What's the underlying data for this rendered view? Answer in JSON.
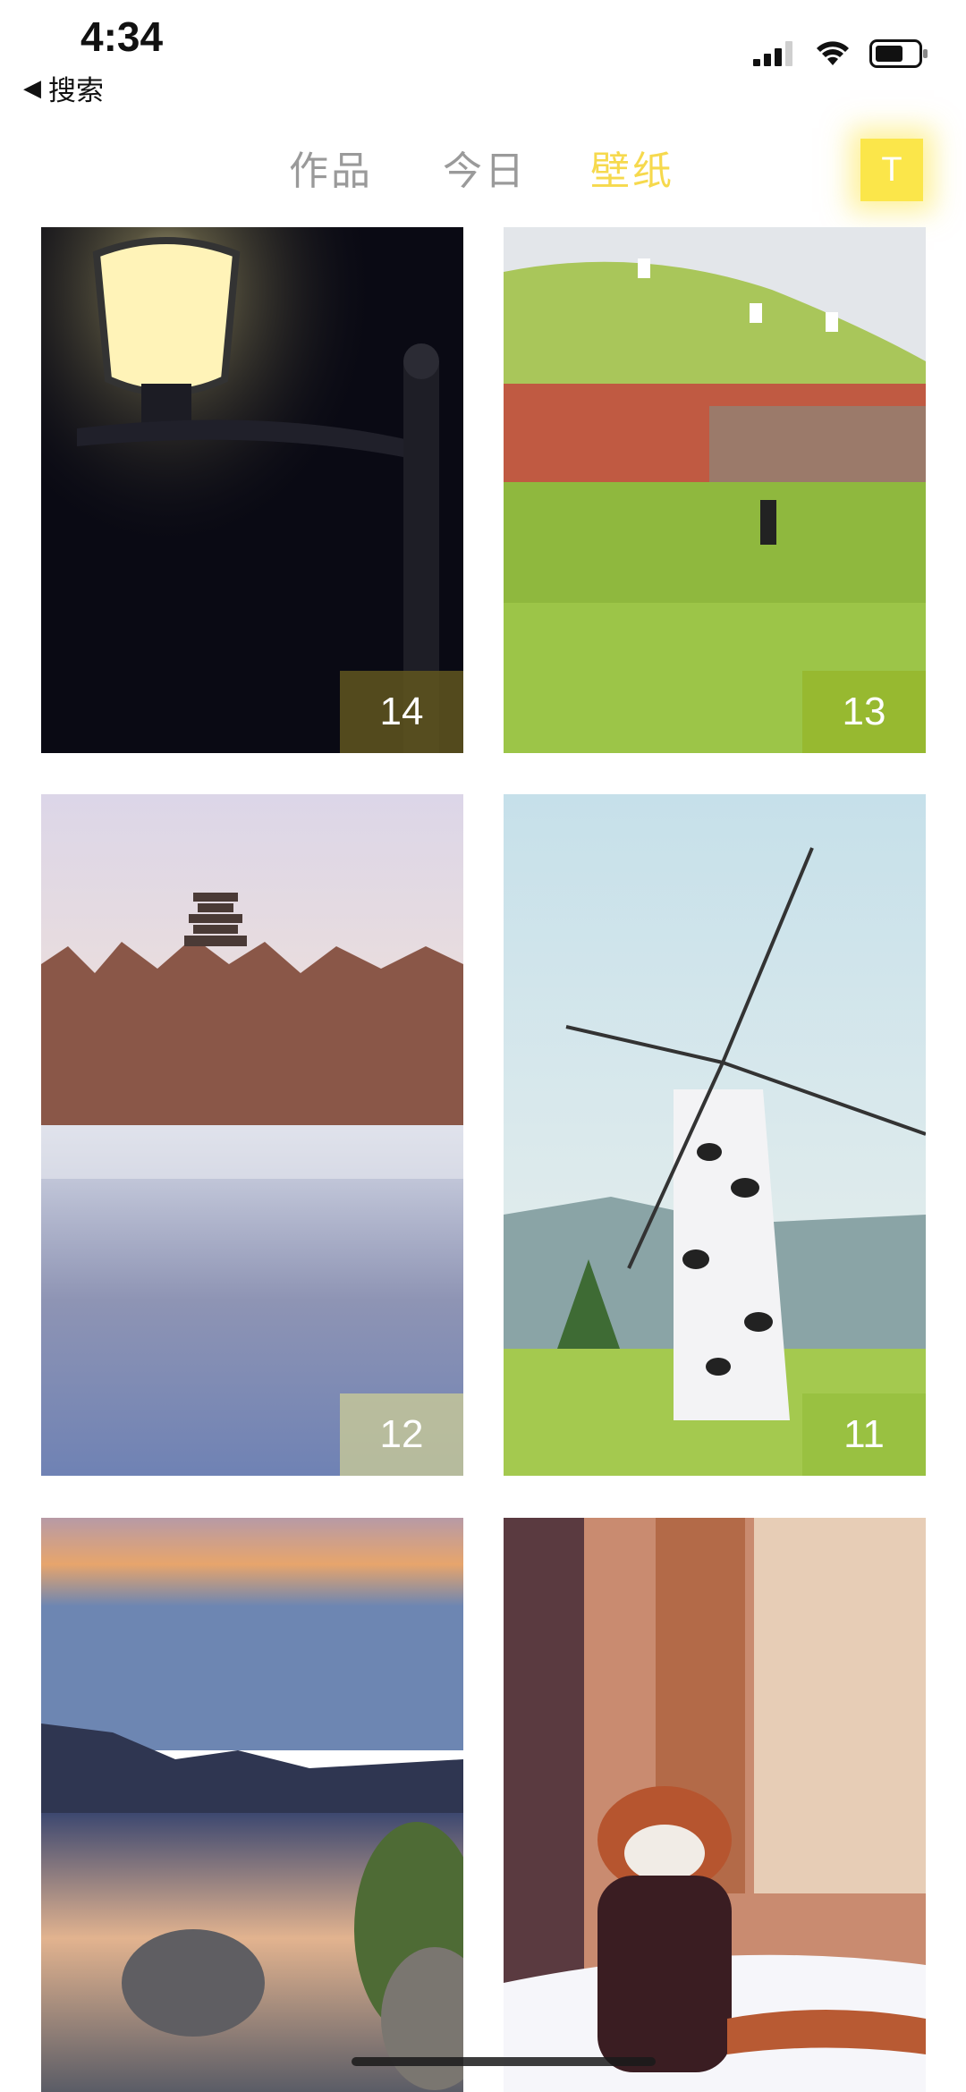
{
  "status_bar": {
    "time": "4:34",
    "back_label": "搜索"
  },
  "tabs": [
    {
      "label": "作品",
      "active": false
    },
    {
      "label": "今日",
      "active": false
    },
    {
      "label": "壁纸",
      "active": true
    }
  ],
  "user_badge": "T",
  "accent_color": "#f6d94d",
  "wallpapers": [
    {
      "count": "14",
      "badge_color": "rgba(96,86,30,0.85)"
    },
    {
      "count": "13",
      "badge_color": "rgba(150,180,40,0.75)"
    },
    {
      "count": "12",
      "badge_color": "rgba(205,205,150,0.75)"
    },
    {
      "count": "11",
      "badge_color": "rgba(150,190,60,0.75)"
    },
    {
      "count": ""
    },
    {
      "count": ""
    }
  ]
}
